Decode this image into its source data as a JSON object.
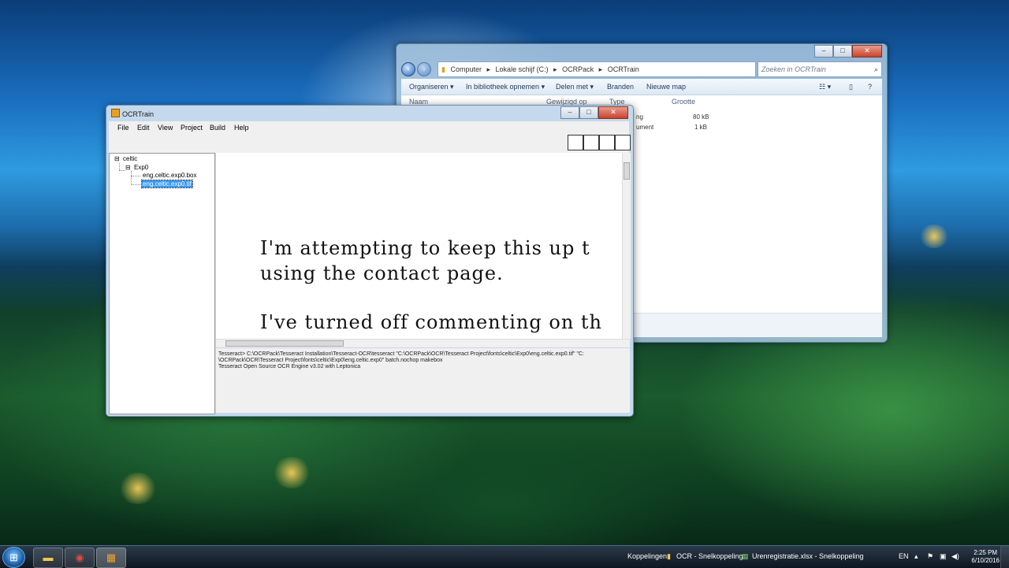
{
  "explorer": {
    "breadcrumb": [
      "Computer",
      "Lokale schijf (C:)",
      "OCRPack",
      "OCRTrain"
    ],
    "search_placeholder": "Zoeken in OCRTrain",
    "toolbar": [
      "Organiseren ▾",
      "In bibliotheek opnemen ▾",
      "Delen met ▾",
      "Branden",
      "Nieuwe map"
    ],
    "columns": [
      "Naam",
      "Gewijzigd op",
      "Type",
      "Grootte"
    ],
    "rows": [
      {
        "type": "ng",
        "size": "80 kB"
      },
      {
        "type": "ument",
        "size": "1 kB"
      }
    ],
    "caption": {
      "minimize": "‒",
      "maximize": "□",
      "close": "✕"
    }
  },
  "ocr": {
    "title": "OCRTrain",
    "menu": [
      "File",
      "Edit",
      "View",
      "Project",
      "Build",
      "Help"
    ],
    "tree": {
      "root": "celtic",
      "child": "Exp0",
      "files": [
        "eng.celtic.exp0.box",
        "eng.celtic.exp0.tif"
      ]
    },
    "canvas_lines": [
      "I'm attempting to keep this up t",
      "using the contact page.",
      "I've turned off commenting on th"
    ],
    "console_lines": [
      "Tesseract> C:\\OCRPack\\Tesseract Installation\\Tesseract-OCR\\tesseract \"C:\\OCRPack\\OCR\\Tesseract Project\\fonts\\celtic\\Exp0\\eng.celtic.exp0.tif\" \"C:",
      "\\OCRPack\\OCR\\Tesseract Project\\fonts\\celtic\\Exp0\\eng.celtic.exp0\" batch.nochop makebox",
      "Tesseract Open Source OCR Engine v3.02 with Leptonica"
    ]
  },
  "taskbar": {
    "links_label": "Koppelingen",
    "shortcut1": "OCR - Snelkoppeling",
    "shortcut2": "Urenregistratie.xlsx - Snelkoppeling",
    "lang": "EN",
    "time": "2:25 PM",
    "date": "6/10/2016"
  }
}
